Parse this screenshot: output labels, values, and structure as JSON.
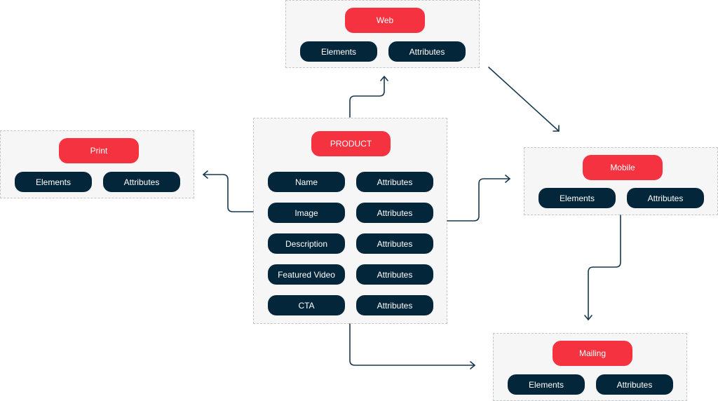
{
  "colors": {
    "header_pill": "#f53340",
    "item_pill": "#04263a",
    "connector": "#16394d",
    "group_bg": "#f6f6f7"
  },
  "product": {
    "title": "PRODUCT",
    "rows": [
      {
        "element": "Name",
        "attribute": "Attributes"
      },
      {
        "element": "Image",
        "attribute": "Attributes"
      },
      {
        "element": "Description",
        "attribute": "Attributes"
      },
      {
        "element": "Featured Video",
        "attribute": "Attributes"
      },
      {
        "element": "CTA",
        "attribute": "Attributes"
      }
    ]
  },
  "channels": {
    "web": {
      "title": "Web",
      "elements": "Elements",
      "attributes": "Attributes"
    },
    "print": {
      "title": "Print",
      "elements": "Elements",
      "attributes": "Attributes"
    },
    "mobile": {
      "title": "Mobile",
      "elements": "Elements",
      "attributes": "Attributes"
    },
    "mailing": {
      "title": "Mailing",
      "elements": "Elements",
      "attributes": "Attributes"
    }
  },
  "connections": [
    {
      "from": "PRODUCT",
      "to": "Web"
    },
    {
      "from": "PRODUCT",
      "to": "Print"
    },
    {
      "from": "PRODUCT",
      "to": "Mobile"
    },
    {
      "from": "PRODUCT",
      "to": "Mailing"
    },
    {
      "from": "Web",
      "to": "Mobile"
    },
    {
      "from": "Mobile",
      "to": "Mailing"
    }
  ]
}
